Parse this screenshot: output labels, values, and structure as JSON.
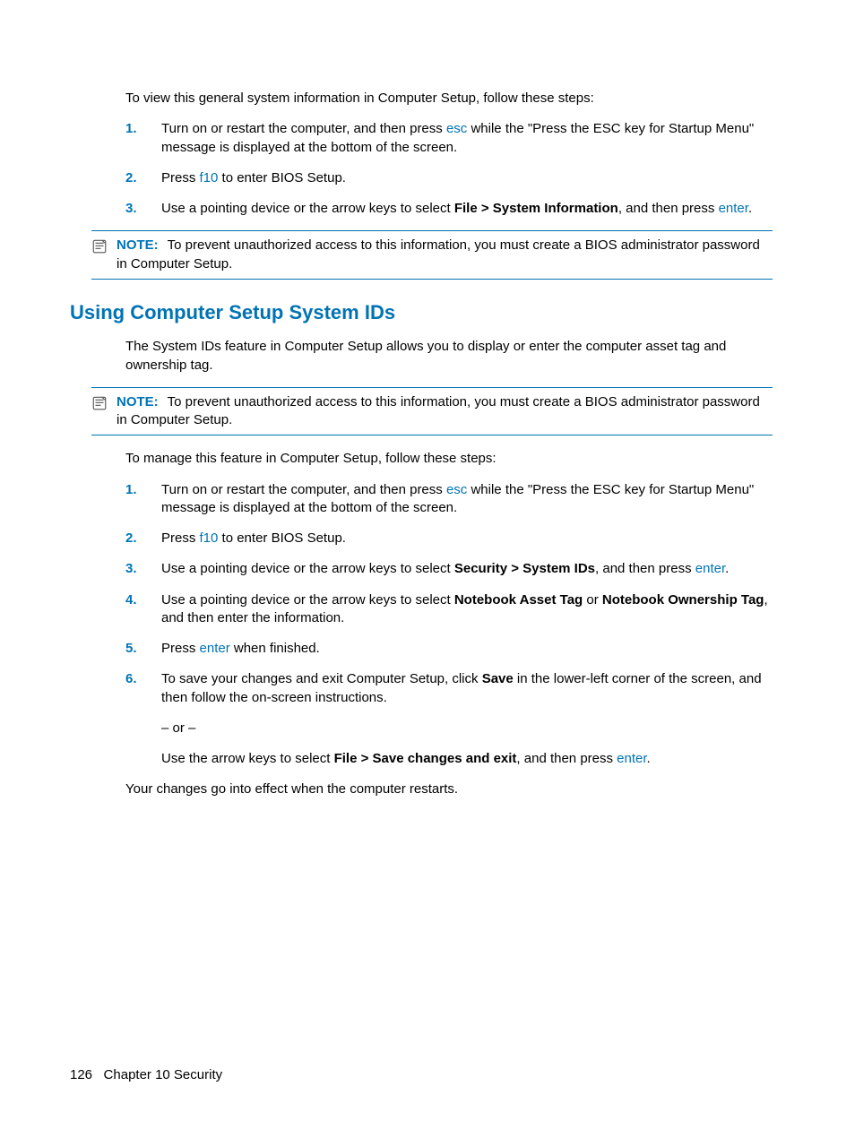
{
  "intro1": "To view this general system information in Computer Setup, follow these steps:",
  "list1": {
    "s1": {
      "n": "1.",
      "pre": "Turn on or restart the computer, and then press ",
      "key": "esc",
      "post": " while the \"Press the ESC key for Startup Menu\" message is displayed at the bottom of the screen."
    },
    "s2": {
      "n": "2.",
      "pre": "Press ",
      "key": "f10",
      "post": " to enter BIOS Setup."
    },
    "s3": {
      "n": "3.",
      "pre": "Use a pointing device or the arrow keys to select ",
      "bold": "File > System Information",
      "mid": ", and then press ",
      "key": "enter",
      "post": "."
    }
  },
  "note1": {
    "label": "NOTE:",
    "text": "To prevent unauthorized access to this information, you must create a BIOS administrator password in Computer Setup."
  },
  "heading": "Using Computer Setup System IDs",
  "intro2": "The System IDs feature in Computer Setup allows you to display or enter the computer asset tag and ownership tag.",
  "note2": {
    "label": "NOTE:",
    "text": "To prevent unauthorized access to this information, you must create a BIOS administrator password in Computer Setup."
  },
  "intro3": "To manage this feature in Computer Setup, follow these steps:",
  "list2": {
    "s1": {
      "n": "1.",
      "pre": "Turn on or restart the computer, and then press ",
      "key": "esc",
      "post": " while the \"Press the ESC key for Startup Menu\" message is displayed at the bottom of the screen."
    },
    "s2": {
      "n": "2.",
      "pre": "Press ",
      "key": "f10",
      "post": " to enter BIOS Setup."
    },
    "s3": {
      "n": "3.",
      "pre": "Use a pointing device or the arrow keys to select ",
      "bold": "Security > System IDs",
      "mid": ", and then press ",
      "key": "enter",
      "post": "."
    },
    "s4": {
      "n": "4.",
      "pre": "Use a pointing device or the arrow keys to select ",
      "bold1": "Notebook Asset Tag",
      "or": " or ",
      "bold2": "Notebook Ownership Tag",
      "post": ", and then enter the information."
    },
    "s5": {
      "n": "5.",
      "pre": "Press ",
      "key": "enter",
      "post": " when finished."
    },
    "s6": {
      "n": "6.",
      "pre": "To save your changes and exit Computer Setup, click ",
      "bold": "Save",
      "post": " in the lower-left corner of the screen, and then follow the on-screen instructions."
    }
  },
  "orline": "– or –",
  "alt": {
    "pre": "Use the arrow keys to select ",
    "bold": "File > Save changes and exit",
    "mid": ", and then press ",
    "key": "enter",
    "post": "."
  },
  "closing": "Your changes go into effect when the computer restarts.",
  "footer": {
    "page": "126",
    "chapter": "Chapter 10   Security"
  }
}
